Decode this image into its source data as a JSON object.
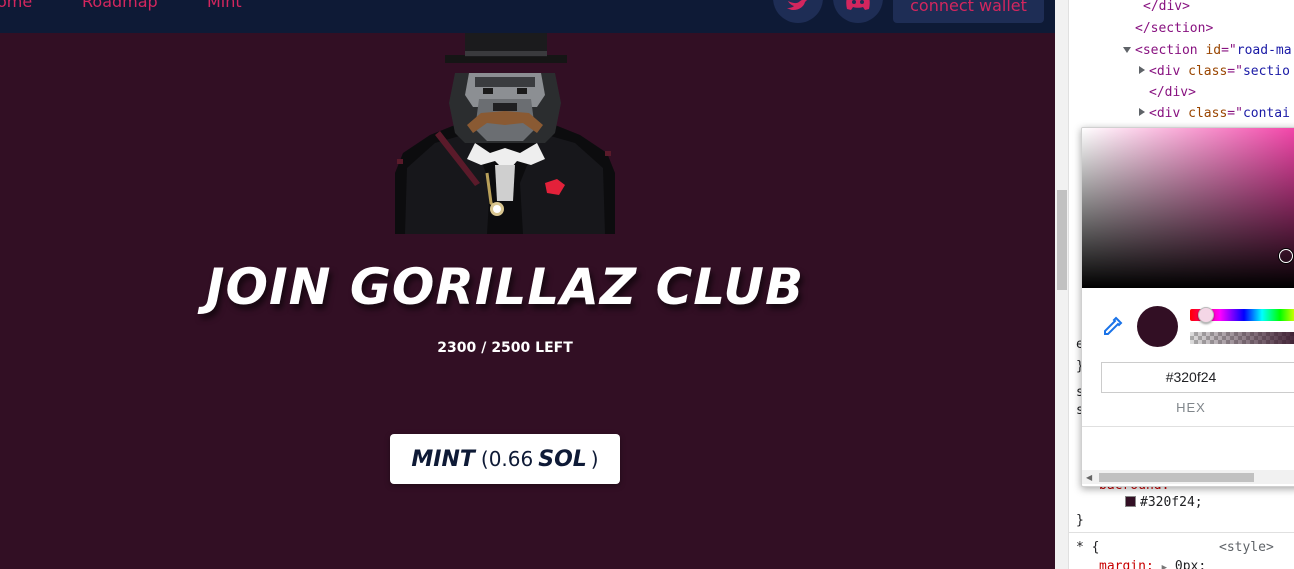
{
  "nav": {
    "links": [
      "ome",
      "Roadmap",
      "Mint"
    ],
    "connect_wallet": "connect wallet"
  },
  "hero": {
    "title": "JOIN GORILLAZ CLUB",
    "supply_remaining": "2300",
    "supply_total": "2500",
    "supply_suffix": "LEFT",
    "supply_sep": "/"
  },
  "mint_button": {
    "label": "MINT",
    "open_paren": "(",
    "price": "0.66",
    "unit": "SOL",
    "close_paren": ")"
  },
  "devtools": {
    "lines": [
      {
        "indent": 1,
        "text": "</div>"
      },
      {
        "indent": 1,
        "text": "</section>"
      },
      {
        "indent": 0,
        "tag": "section",
        "attr": "id",
        "value": "road-ma"
      },
      {
        "indent": 1,
        "tag": "div",
        "attr": "class",
        "value": "sectio"
      },
      {
        "indent": 1,
        "text": "</div>"
      },
      {
        "indent": 1,
        "tag": "div",
        "attr": "class",
        "value": "contai"
      }
    ],
    "styles": {
      "property_partial": "bac",
      "property_rest": "round:",
      "color_value": "#320f24;",
      "close_brace": "}",
      "rule_selector": "* {",
      "rule_source": "<style>",
      "next_property": "margin:",
      "next_value": "0px;",
      "left_fragments": [
        "e",
        "}",
        "s",
        "s"
      ]
    }
  },
  "color_picker": {
    "hex_value": "#320f24",
    "format_label": "HEX",
    "current_color": "#320f24"
  },
  "colors": {
    "page_bg": "#320f24",
    "nav_bg": "#0e1a36",
    "accent": "#d3265e"
  }
}
